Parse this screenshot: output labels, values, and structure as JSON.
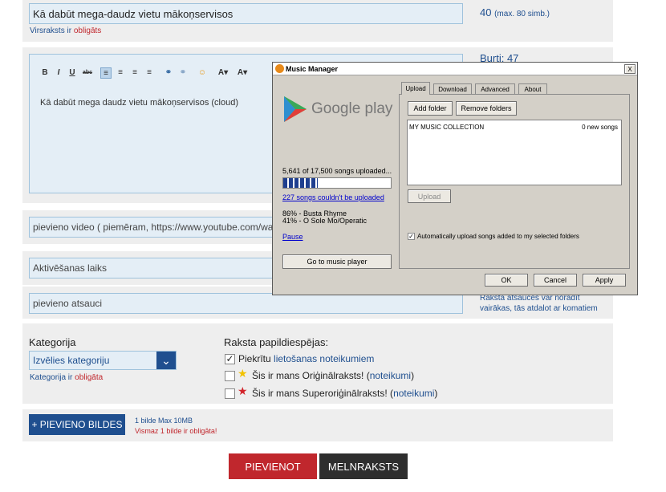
{
  "title_field": {
    "value": "Kā dabūt mega-daudz vietu mākoņservisos",
    "counter": "40",
    "counter_hint": "(max. 80 simb.)",
    "hint": "Virsraksts ir",
    "hint_required": "obligāts"
  },
  "editor": {
    "content": "Kā dabūt mega daudz vietu mākoņservisos (cloud)",
    "word_count": "Burti: 47",
    "tools": [
      "B",
      "I",
      "U",
      "abc"
    ]
  },
  "video_field": {
    "placeholder": "pievieno video ( piemēram, https://www.youtube.com/watch?v=3"
  },
  "activation_field": {
    "placeholder": "Aktivēšanas laiks"
  },
  "source_field": {
    "placeholder": "pievieno atsauci",
    "hint": "Raksta atsauces var norādīt vairākas, tās atdalot ar komatiem"
  },
  "category": {
    "label": "Kategorija",
    "placeholder": "Izvēlies kategoriju",
    "hint": "Kategorija ir",
    "hint_required": "obligāta"
  },
  "options": {
    "label": "Raksta papildiespējas:",
    "terms_prefix": "Piekrītu",
    "terms_link": "lietošanas noteikumiem",
    "original_prefix": "Šis ir mans Oriģinālraksts! (",
    "original_link": "noteikumi",
    "original_suffix": ")",
    "super_prefix": "Šis ir mans Superoriģinālraksts! (",
    "super_link": "noteikumi",
    "super_suffix": ")"
  },
  "images": {
    "button": "+ PIEVIENO BILDES",
    "info": "1 bilde Max 10MB",
    "required": "Vismaz 1 bilde ir obligāta!"
  },
  "actions": {
    "submit": "PIEVIENOT",
    "draft": "MELNRAKSTS"
  },
  "music_manager": {
    "title": "Music Manager",
    "close": "X",
    "brand": "Google play",
    "status": "5,641 of 17,500 songs uploaded...",
    "progress_fraction": 0.32,
    "failed_link": "227 songs couldn't be uploaded",
    "current1": "86% - Busta Rhyme",
    "current2": "41% - O Sole Mo/Operatic",
    "pause": "Pause",
    "go_button": "Go to music player",
    "tabs": [
      "Upload",
      "Download",
      "Advanced",
      "About"
    ],
    "add_folder": "Add folder",
    "remove_folders": "Remove folders",
    "collection_name": "MY MUSIC COLLECTION",
    "collection_new": "0 new songs",
    "upload_button": "Upload",
    "auto_upload": "Automatically upload songs added to my selected folders",
    "ok": "OK",
    "cancel": "Cancel",
    "apply": "Apply"
  },
  "colors": {
    "accent_blue": "#1f4f8f",
    "submit_red": "#c0272d",
    "draft_dark": "#2e2e2e"
  }
}
